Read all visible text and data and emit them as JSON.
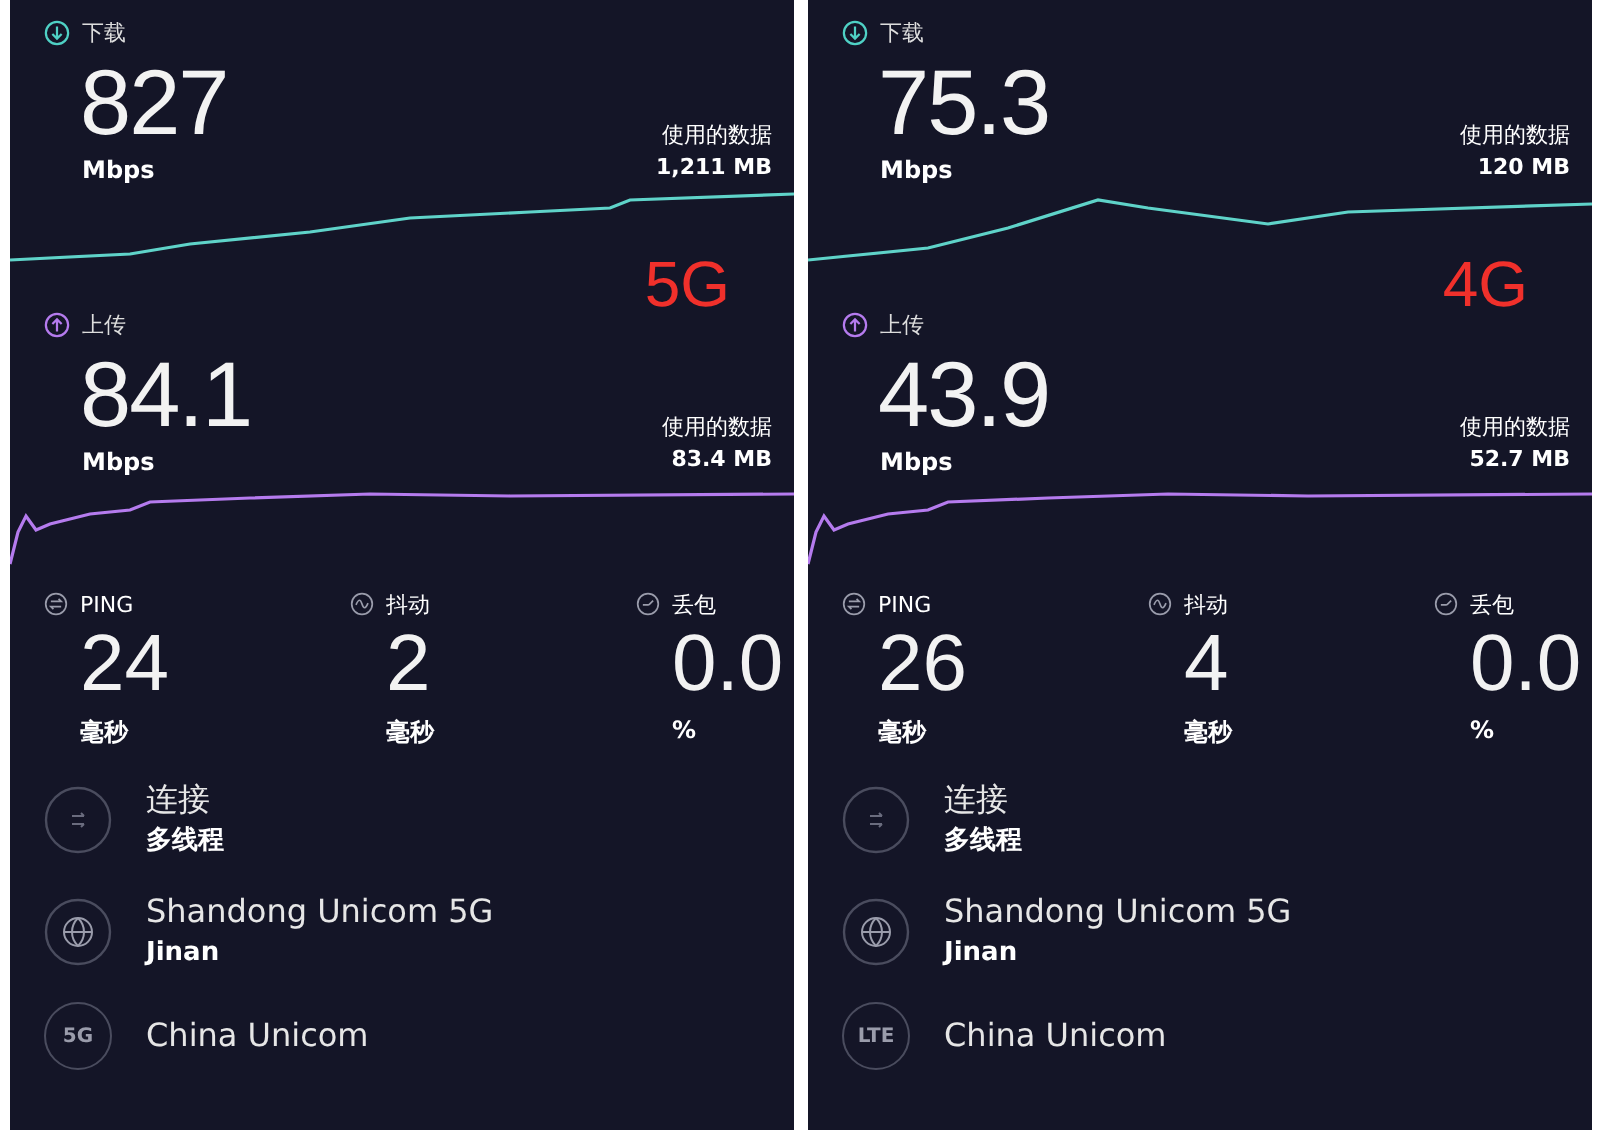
{
  "panels": [
    {
      "download": {
        "label": "下载",
        "value": "827",
        "unit": "Mbps",
        "data_label": "使用的数据",
        "data_value": "1,211 MB"
      },
      "network_tag": "5G",
      "upload": {
        "label": "上传",
        "value": "84.1",
        "unit": "Mbps",
        "data_label": "使用的数据",
        "data_value": "83.4 MB"
      },
      "stats": [
        {
          "kind": "ping",
          "label": "PING",
          "value": "24",
          "unit": "毫秒"
        },
        {
          "kind": "jitter",
          "label": "抖动",
          "value": "2",
          "unit": "毫秒"
        },
        {
          "kind": "loss",
          "label": "丢包",
          "value": "0.0",
          "unit": "%"
        }
      ],
      "connection": {
        "title": "连接",
        "value": "多线程"
      },
      "server": {
        "name": "Shandong Unicom 5G",
        "location": "Jinan"
      },
      "provider": {
        "badge": "5G",
        "name": "China Unicom"
      }
    },
    {
      "download": {
        "label": "下载",
        "value": "75.3",
        "unit": "Mbps",
        "data_label": "使用的数据",
        "data_value": "120 MB"
      },
      "network_tag": "4G",
      "upload": {
        "label": "上传",
        "value": "43.9",
        "unit": "Mbps",
        "data_label": "使用的数据",
        "data_value": "52.7 MB"
      },
      "stats": [
        {
          "kind": "ping",
          "label": "PING",
          "value": "26",
          "unit": "毫秒"
        },
        {
          "kind": "jitter",
          "label": "抖动",
          "value": "4",
          "unit": "毫秒"
        },
        {
          "kind": "loss",
          "label": "丢包",
          "value": "0.0",
          "unit": "%"
        }
      ],
      "connection": {
        "title": "连接",
        "value": "多线程"
      },
      "server": {
        "name": "Shandong Unicom 5G",
        "location": "Jinan"
      },
      "provider": {
        "badge": "LTE",
        "name": "China Unicom"
      }
    }
  ]
}
